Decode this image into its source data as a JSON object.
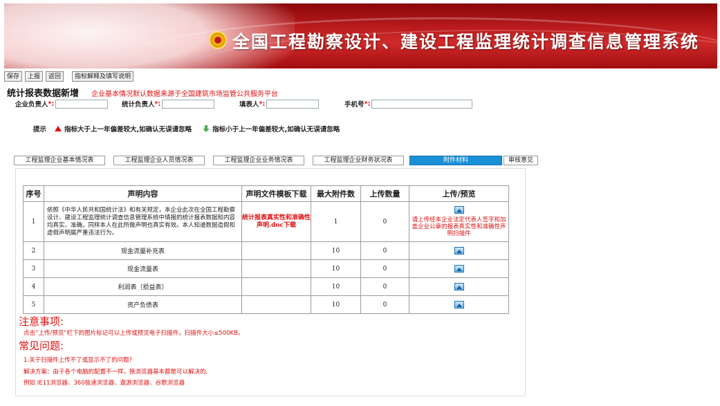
{
  "banner": {
    "title": "全国工程勘察设计、建设工程监理统计调查信息管理系统"
  },
  "toolbar": {
    "save": "保存",
    "report": "上报",
    "back": "返回",
    "guide": "指标解释及填写说明"
  },
  "page": {
    "heading": "统计报表数据新增",
    "notice": "企业基本情况默认数据来源于全国建筑市场监管公共服务平台"
  },
  "persons": {
    "enterprise_head": "企业负责人",
    "stats_head": "统计负责人",
    "filler": "填表人",
    "phone": "手机号",
    "star": "*:",
    "phone_suffix": "*:"
  },
  "hint": {
    "label": "提示",
    "up": "指标大于上一年偏差较大,如确认无误请忽略",
    "down": "指标小于上一年偏差较大,如确认无误请忽略"
  },
  "tabs": [
    {
      "label": "工程监理企业基本情况表",
      "active": false
    },
    {
      "label": "工程监理企业人员情况表",
      "active": false
    },
    {
      "label": "工程监理企业业务情况表",
      "active": false
    },
    {
      "label": "工程监理企业财务状况表",
      "active": false
    },
    {
      "label": "附件材料",
      "active": true
    },
    {
      "label": "审核意见",
      "active": false
    }
  ],
  "table": {
    "headers": [
      "序号",
      "声明内容",
      "声明文件模板下载",
      "最大附件数",
      "上传数量",
      "上传/预览"
    ],
    "rows": [
      {
        "no": "1",
        "content": "依照《中华人民共和国统计法》和有关规定，本企业此次在全国工程勘察设计、建设工程监理统计调查信息管理系统中填报的统计报表数据和内容均真实、准确，同样本人在此所做声明也真实有效。本人知道数据造假和虚假声明属严重违法行为。",
        "download": "统计报表真实性和准确性声明.doc下载",
        "max": "1",
        "count": "0",
        "upload_note": "请上传经本企业法定代表人签字和加盖企业公章的报表真实性和准确性声明扫描件"
      },
      {
        "no": "2",
        "content": "现金流量补充表",
        "download": "",
        "max": "10",
        "count": "0",
        "upload_note": ""
      },
      {
        "no": "3",
        "content": "现金流量表",
        "download": "",
        "max": "10",
        "count": "0",
        "upload_note": ""
      },
      {
        "no": "4",
        "content": "利润表（损益表）",
        "download": "",
        "max": "10",
        "count": "0",
        "upload_note": ""
      },
      {
        "no": "5",
        "content": "资产负债表",
        "download": "",
        "max": "10",
        "count": "0",
        "upload_note": ""
      }
    ]
  },
  "notes": {
    "title": "注意事项:",
    "line1": "点击“上传/预览”栏下的图片标记可以上传或预览电子扫描件，扫描件大小≤500KB。"
  },
  "faq": {
    "title": "常见问题:",
    "q1": "1.关于扫描件上传不了或显示不了的问题?",
    "a1": "解决方案：由于各个电脑的配置不一样，换浏览器基本都是可以解决的,",
    "a2": "例如 IE11浏览器、360极速浏览器、遨游浏览器、谷歌浏览器"
  },
  "colors": {
    "accent": "#1a8fd6",
    "warn": "#dd1111",
    "banner": "#b81a1c"
  }
}
